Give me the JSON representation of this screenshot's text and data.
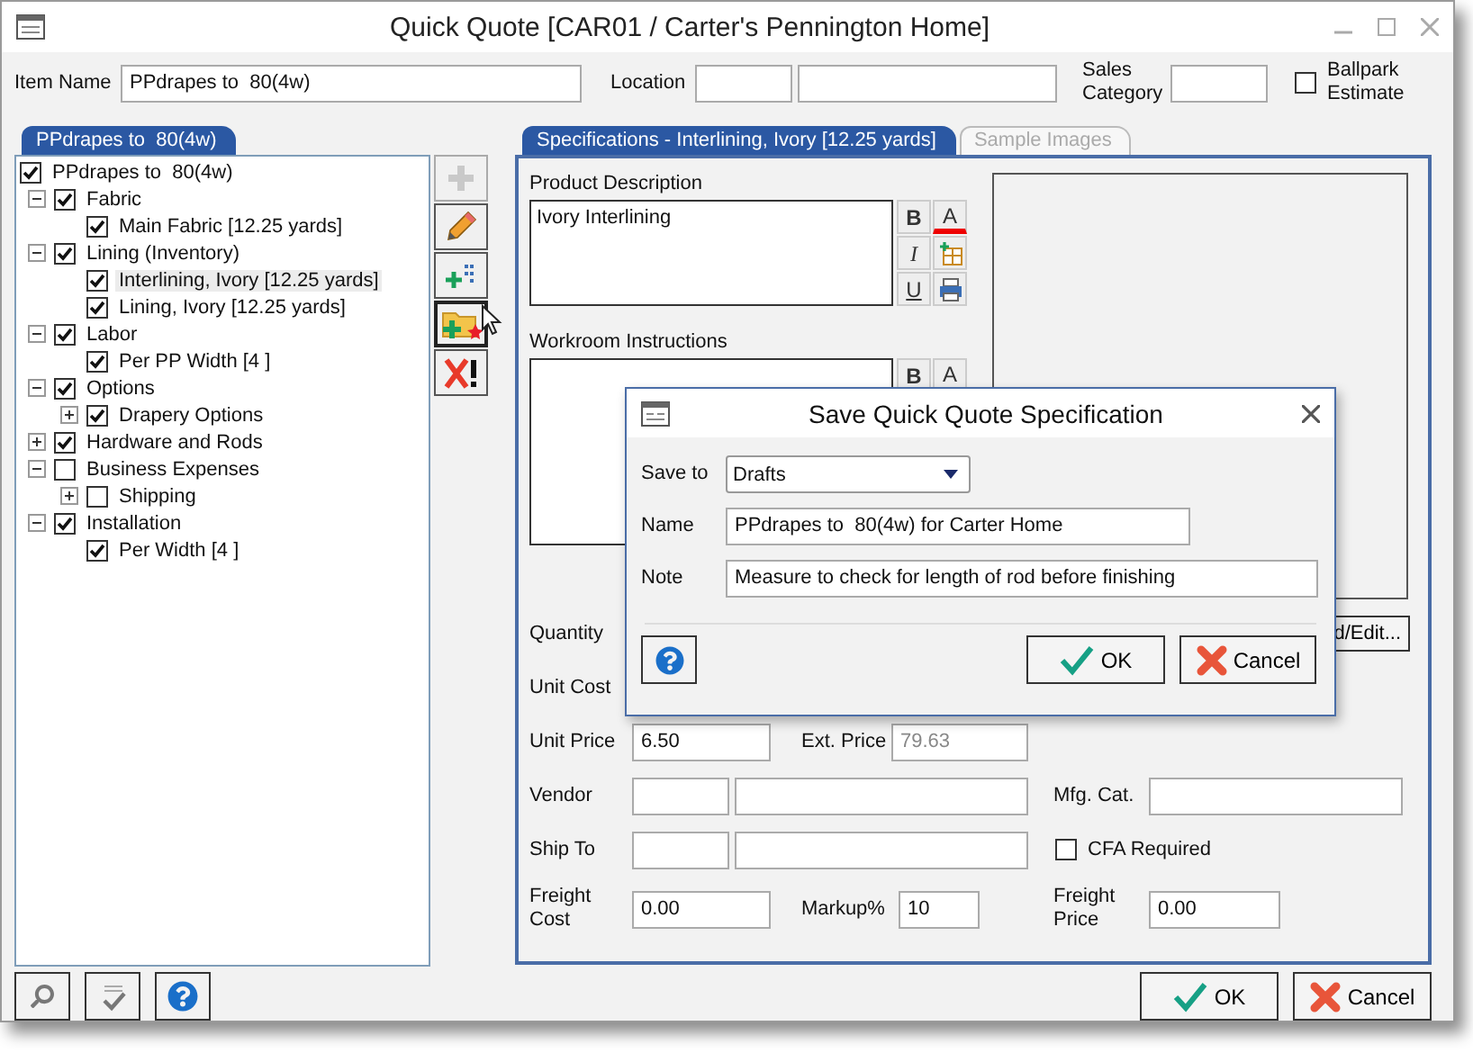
{
  "window": {
    "title": "Quick Quote [CAR01 / Carter's Pennington Home]"
  },
  "header": {
    "item_name": {
      "label": "Item Name",
      "value": "PPdrapes to  80(4w)"
    },
    "location": {
      "label": "Location"
    },
    "sales_category": {
      "label": "Sales Category"
    },
    "ballpark_estimate": {
      "label": "Ballpark Estimate",
      "checked": false
    }
  },
  "tree": {
    "tab": "PPdrapes to  80(4w)",
    "items": [
      {
        "label": "PPdrapes to  80(4w)",
        "checked": true,
        "selected": false,
        "children": [
          {
            "label": "Fabric",
            "checked": true,
            "selected": false,
            "expanded": true,
            "children": [
              {
                "label": "Main Fabric [12.25 yards]",
                "checked": true,
                "selected": false
              }
            ]
          },
          {
            "label": "Lining (Inventory)",
            "checked": true,
            "selected": false,
            "expanded": true,
            "children": [
              {
                "label": "Interlining, Ivory [12.25 yards]",
                "checked": true,
                "selected": true
              },
              {
                "label": "Lining, Ivory [12.25 yards]",
                "checked": true,
                "selected": false
              }
            ]
          },
          {
            "label": "Labor",
            "checked": true,
            "selected": false,
            "expanded": true,
            "children": [
              {
                "label": "Per PP Width [4 ]",
                "checked": true,
                "selected": false
              }
            ]
          },
          {
            "label": "Options",
            "checked": true,
            "selected": false,
            "expanded": true,
            "children": [
              {
                "label": "Drapery Options",
                "checked": true,
                "selected": false,
                "expanded": false
              }
            ]
          },
          {
            "label": "Hardware and Rods",
            "checked": true,
            "selected": false,
            "expanded": false
          },
          {
            "label": "Business Expenses",
            "checked": false,
            "selected": false,
            "expanded": true,
            "children": [
              {
                "label": "Shipping",
                "checked": false,
                "selected": false,
                "expanded": false
              }
            ]
          },
          {
            "label": "Installation",
            "checked": true,
            "selected": false,
            "expanded": true,
            "children": [
              {
                "label": "Per Width [4 ]",
                "checked": true,
                "selected": false
              }
            ]
          }
        ]
      }
    ]
  },
  "toolbar": [
    {
      "kind": "add",
      "disabled": true,
      "focused": false
    },
    {
      "kind": "edit",
      "disabled": false,
      "focused": false
    },
    {
      "kind": "add-child",
      "disabled": false,
      "focused": false
    },
    {
      "kind": "save",
      "disabled": false,
      "focused": true
    },
    {
      "kind": "delete",
      "disabled": false,
      "focused": false
    }
  ],
  "spec_tabs": [
    {
      "label": "Specifications - Interlining, Ivory [12.25 yards]",
      "selected": true
    },
    {
      "label": "Sample Images",
      "selected": false
    }
  ],
  "spec": {
    "product_description": {
      "label": "Product Description",
      "value": "Ivory Interlining",
      "tools": [
        {
          "kind": "bold",
          "label": "B"
        },
        {
          "kind": "font-color",
          "label": "A"
        },
        {
          "kind": "italic",
          "label": "I"
        },
        {
          "kind": "insert-field"
        },
        {
          "kind": "underline",
          "label": "U"
        },
        {
          "kind": "print"
        }
      ]
    },
    "workroom_instructions": {
      "label": "Workroom Instructions",
      "tools": [
        {
          "kind": "bold",
          "label": "B"
        },
        {
          "kind": "font-color",
          "label": "A"
        }
      ]
    },
    "add_edit_button": "d/Edit...",
    "quantity": {
      "label": "Quantity"
    },
    "unit_cost": {
      "label": "Unit Cost"
    },
    "unit_price": {
      "label": "Unit Price",
      "value": "6.50"
    },
    "ext_price": {
      "label": "Ext. Price",
      "value": "79.63",
      "disabled": true
    },
    "vendor": {
      "label": "Vendor"
    },
    "mfg_cat": {
      "label": "Mfg. Cat."
    },
    "ship_to": {
      "label": "Ship To"
    },
    "cfa_required": {
      "label": "CFA Required",
      "checked": false
    },
    "freight_cost": {
      "label": "Freight Cost",
      "value": "0.00"
    },
    "markup": {
      "label": "Markup%",
      "value": "10"
    },
    "freight_price": {
      "label": "Freight Price",
      "value": "0.00"
    }
  },
  "dialog": {
    "title": "Save Quick Quote Specification",
    "save_to": {
      "label": "Save to",
      "value": "Drafts"
    },
    "name": {
      "label": "Name",
      "value": "PPdrapes to  80(4w) for Carter Home"
    },
    "note": {
      "label": "Note",
      "value": "Measure to check for length of rod before finishing"
    },
    "ok_button": "OK",
    "cancel_button": "Cancel"
  },
  "footer": {
    "ok_button": "OK",
    "cancel_button": "Cancel"
  }
}
